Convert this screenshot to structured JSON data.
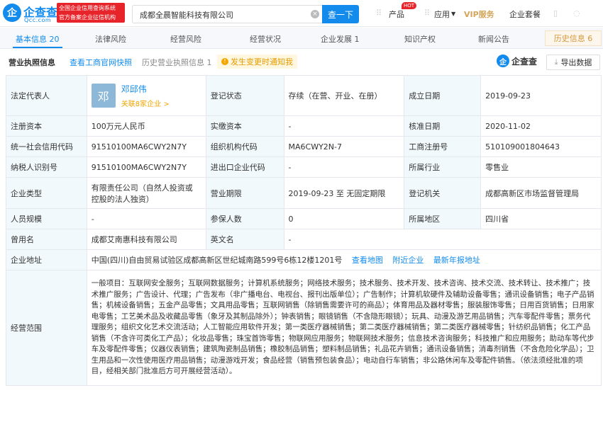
{
  "header": {
    "logo_mark": "企",
    "logo_text": "企查查",
    "logo_sub": "Qcc.com",
    "badge_line1": "全国企业信用查询系统",
    "badge_line2": "官方备案企业征信机构",
    "search_value": "成都全晨智能科技有限公司",
    "search_button": "查一下",
    "hot_badge": "HOT",
    "nav_products": "产品",
    "nav_apps": "应用",
    "nav_vip": "VIP服务",
    "nav_package": "企业套餐"
  },
  "tabs": [
    {
      "label": "基本信息 20"
    },
    {
      "label": "法律风险"
    },
    {
      "label": "经营风险"
    },
    {
      "label": "经营状况"
    },
    {
      "label": "企业发展 1"
    },
    {
      "label": "知识产权"
    },
    {
      "label": "新闻公告"
    },
    {
      "label": "历史信息 6"
    }
  ],
  "subbar": {
    "title": "营业执照信息",
    "link_gov": "查看工商官网快照",
    "history": "历史营业执照信息 1",
    "alert": "发生变更时通知我",
    "qcc_mark": "企",
    "qcc_name": "企查查",
    "export": "导出数据"
  },
  "info": {
    "legal_rep_label": "法定代表人",
    "avatar_char": "邓",
    "legal_rep_name": "邓邱伟",
    "legal_rep_link": "关联8家企业 >",
    "reg_status_label": "登记状态",
    "reg_status": "存续（在营、开业、在册）",
    "est_date_label": "成立日期",
    "est_date": "2019-09-23",
    "capital_label": "注册资本",
    "capital": "100万元人民币",
    "paid_capital_label": "实缴资本",
    "paid_capital": "-",
    "approve_date_label": "核准日期",
    "approve_date": "2020-11-02",
    "credit_code_label": "统一社会信用代码",
    "credit_code": "91510100MA6CWY2N7Y",
    "org_code_label": "组织机构代码",
    "org_code": "MA6CWY2N-7",
    "reg_no_label": "工商注册号",
    "reg_no": "510109001804643",
    "tax_id_label": "纳税人识别号",
    "tax_id": "91510100MA6CWY2N7Y",
    "import_code_label": "进出口企业代码",
    "import_code": "-",
    "industry_label": "所属行业",
    "industry": "零售业",
    "type_label": "企业类型",
    "type_line1": "有限责任公司（自然人投资或",
    "type_line2": "控股的法人独资）",
    "term_label": "营业期限",
    "term": "2019-09-23 至 无固定期限",
    "authority_label": "登记机关",
    "authority": "成都高新区市场监督管理局",
    "staff_label": "人员规模",
    "staff": "-",
    "insured_label": "参保人数",
    "insured": "0",
    "region_label": "所属地区",
    "region": "四川省",
    "former_name_label": "曾用名",
    "former_name": "成都艾南惠科技有限公司",
    "english_name_label": "英文名",
    "english_name": "-",
    "address_label": "企业地址",
    "address": "中国(四川)自由贸易试验区成都高新区世纪城南路599号6栋12楼1201号",
    "address_map": "查看地图",
    "address_nearby": "附近企业",
    "address_report": "最新年报地址",
    "scope_label": "经营范围",
    "scope": "一般项目：互联网安全服务；互联网数据服务；计算机系统服务；网络技术服务；技术服务、技术开发、技术咨询、技术交流、技术转让、技术推广；技术推广服务；广告设计、代理；广告发布（非广播电台、电视台、报刊出版单位）；广告制作；计算机软硬件及辅助设备零售；通讯设备销售；电子产品销售；机械设备销售；五金产品零售；文具用品零售；互联网销售（除销售需要许可的商品）；体育用品及器材零售；服装服饰零售；日用百货销售；日用家电零售；工艺美术品及收藏品零售（象牙及其制品除外）；钟表销售；眼镜销售（不含隐形眼镜）；玩具、动漫及游艺用品销售；汽车零配件零售；票务代理服务；组织文化艺术交流活动；人工智能应用软件开发；第一类医疗器械销售；第二类医疗器械销售；第二类医疗器械零售；针纺织品销售；化工产品销售（不含许可类化工产品）；化妆品零售；珠宝首饰零售；物联网应用服务；物联网技术服务；信息技术咨询服务；科技推广和应用服务；助动车等代步车及零配件零售；仪器仪表销售；建筑陶瓷制品销售；橡胶制品销售；塑料制品销售；礼品花卉销售；通讯设备销售；消毒剂销售（不含危险化学品）；卫生用品和一次性使用医疗用品销售；动漫游戏开发；食品经营（销售预包装食品）；电动自行车销售；非公路休闲车及零配件销售。（依法须经批准的项目，经相关部门批准后方可开展经营活动）。"
  },
  "colors": {
    "accent": "#128bed",
    "label_bg": "#f2f9fc",
    "warning": "#f2a600",
    "brand_red": "#e8242b"
  }
}
